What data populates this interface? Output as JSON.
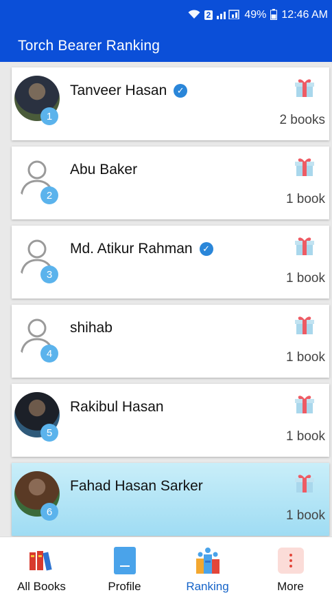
{
  "status_bar": {
    "battery": "49%",
    "time": "12:46 AM",
    "sim_badge": "2"
  },
  "app_bar": {
    "title": "Torch Bearer Ranking"
  },
  "ranking": [
    {
      "rank": "1",
      "name": "Tanveer Hasan",
      "verified": true,
      "books": "2 books",
      "avatar": "photo"
    },
    {
      "rank": "2",
      "name": "Abu Baker",
      "verified": false,
      "books": "1 book",
      "avatar": "blank"
    },
    {
      "rank": "3",
      "name": "Md. Atikur Rahman",
      "verified": true,
      "books": "1 book",
      "avatar": "blank"
    },
    {
      "rank": "4",
      "name": "shihab",
      "verified": false,
      "books": "1 book",
      "avatar": "blank"
    },
    {
      "rank": "5",
      "name": "Rakibul Hasan",
      "verified": false,
      "books": "1 book",
      "avatar": "photo2"
    },
    {
      "rank": "6",
      "name": "Fahad Hasan Sarker",
      "verified": false,
      "books": "1 book",
      "avatar": "photo3",
      "highlighted": true
    }
  ],
  "bottom_nav": [
    {
      "label": "All Books",
      "icon": "books-icon",
      "active": false
    },
    {
      "label": "Profile",
      "icon": "profile-book-icon",
      "active": false
    },
    {
      "label": "Ranking",
      "icon": "ranking-icon",
      "active": true
    },
    {
      "label": "More",
      "icon": "more-icon",
      "active": false
    }
  ],
  "colors": {
    "app_bar": "#0b4fd8",
    "rank_badge": "#5bb3ec",
    "verified": "#2a86d9",
    "active_nav": "#1463c8",
    "highlight_row": "#9fdcf3"
  }
}
